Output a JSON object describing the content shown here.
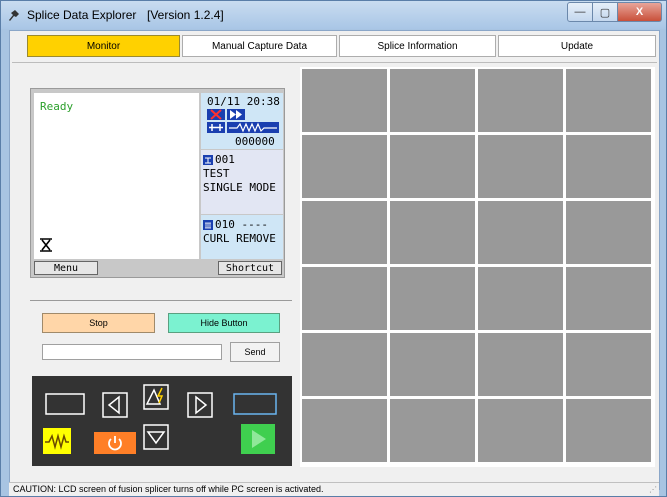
{
  "window": {
    "title": "Splice Data Explorer",
    "version": "[Version 1.2.4]",
    "min_glyph": "—",
    "max_glyph": "▢",
    "close_glyph": "X"
  },
  "tabs": [
    {
      "label": "Monitor",
      "active": true
    },
    {
      "label": "Manual Capture Data",
      "active": false
    },
    {
      "label": "Splice Information",
      "active": false
    },
    {
      "label": "Update",
      "active": false
    }
  ],
  "lcd": {
    "status": "Ready",
    "datetime": "01/11 20:38",
    "counter": "000000",
    "program_number": "001",
    "program_name": "TEST",
    "fiber_mode": "SINGLE MODE",
    "heater_number": "010 ----",
    "heater_name": "CURL REMOVE",
    "menu_label": "Menu",
    "shortcut_label": "Shortcut"
  },
  "controls": {
    "stop_label": "Stop",
    "hide_label": "Hide Button",
    "send_value": "",
    "send_label": "Send"
  },
  "keypad": {
    "keys": [
      "blank-key-left",
      "left-arrow-key",
      "arc-key",
      "right-arrow-key",
      "blank-key-right",
      "waveform-key",
      "power-key",
      "down-arrow-key",
      "start-key"
    ]
  },
  "grid": {
    "rows": 6,
    "cols": 4
  },
  "status_bar": {
    "text": "CAUTION: LCD screen of fusion splicer turns off while PC screen is activated."
  },
  "colors": {
    "active_tab": "#ffd100",
    "stop_button": "#ffd6a8",
    "hide_button": "#7bf2d0",
    "keypad_bg": "#333333",
    "grid_cell": "#999999",
    "lcd_status": "#2ca02c",
    "waveform_key": "#ffff00",
    "power_key": "#ff7f27",
    "start_key": "#3fcf4f"
  }
}
